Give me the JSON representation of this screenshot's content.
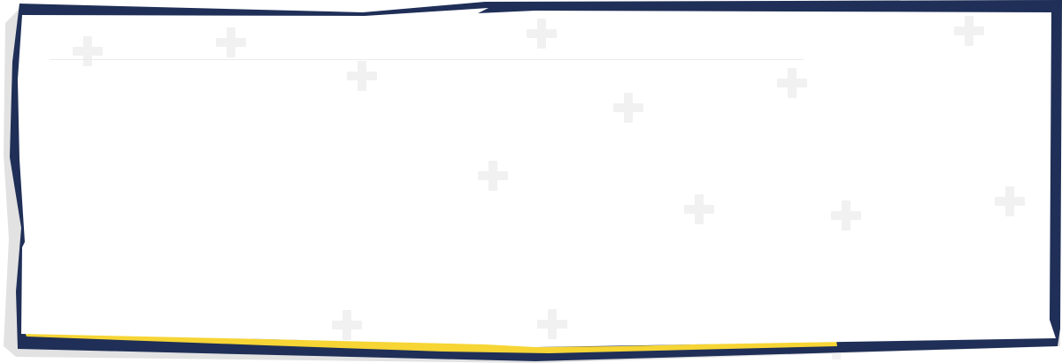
{
  "colors": {
    "frame_navy": "#1f2f57",
    "accent_yellow": "#f6d535",
    "shadow_gray": "#e2e2e2",
    "plus_gray": "#f1f1f1",
    "panel_white": "#ffffff",
    "divider_gray": "#ebebeb"
  },
  "decorations": {
    "pattern_icon": "plus-icon"
  }
}
